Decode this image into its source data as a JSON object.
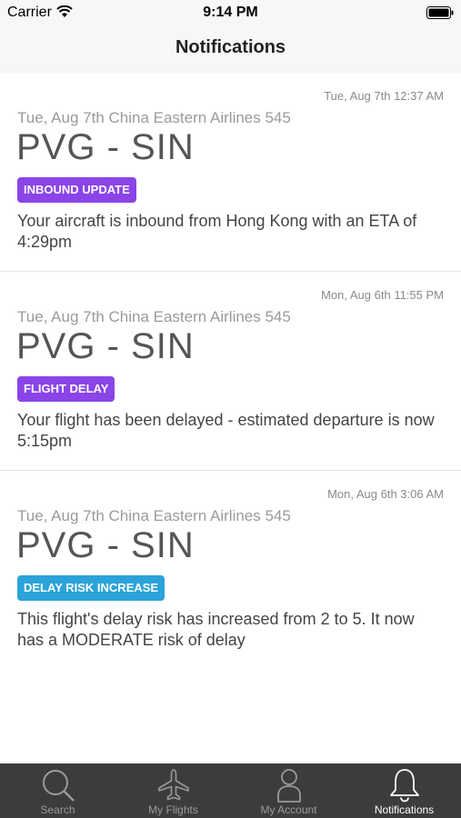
{
  "status_bar": {
    "carrier": "Carrier",
    "time": "9:14 PM"
  },
  "header": {
    "title": "Notifications"
  },
  "notifications": [
    {
      "timestamp": "Tue, Aug 7th 12:37 AM",
      "flight_info": "Tue, Aug 7th China Eastern Airlines 545",
      "route": "PVG - SIN",
      "badge": "INBOUND UPDATE",
      "badge_color": "#8a44e8",
      "message": "Your aircraft is inbound from Hong Kong with an ETA of 4:29pm"
    },
    {
      "timestamp": "Mon, Aug 6th 11:55 PM",
      "flight_info": "Tue, Aug 7th China Eastern Airlines 545",
      "route": "PVG - SIN",
      "badge": "FLIGHT DELAY",
      "badge_color": "#8a44e8",
      "message": "Your flight has been delayed - estimated departure is now 5:15pm"
    },
    {
      "timestamp": "Mon, Aug 6th 3:06 AM",
      "flight_info": "Tue, Aug 7th China Eastern Airlines 545",
      "route": "PVG - SIN",
      "badge": "DELAY RISK INCREASE",
      "badge_color": "#2ba3d9",
      "message": "This flight's delay risk has increased from 2 to 5. It now has a MODERATE risk of delay"
    }
  ],
  "tab_bar": {
    "tabs": [
      {
        "label": "Search",
        "icon": "search-icon"
      },
      {
        "label": "My Flights",
        "icon": "airplane-icon"
      },
      {
        "label": "My Account",
        "icon": "person-icon"
      },
      {
        "label": "Notifications",
        "icon": "bell-icon"
      }
    ],
    "active": "Notifications"
  }
}
